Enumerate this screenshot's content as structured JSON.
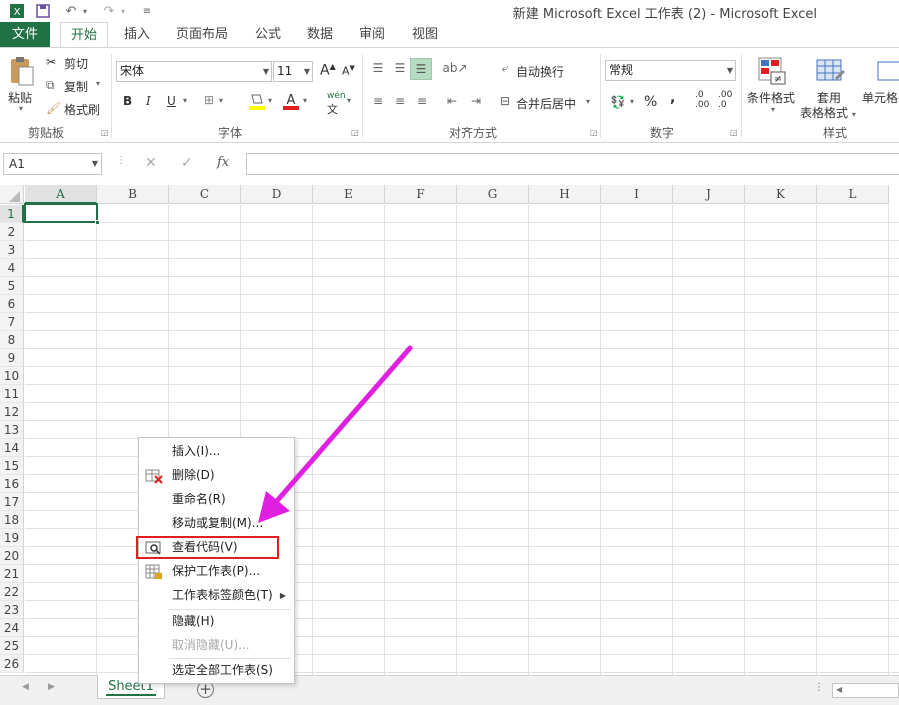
{
  "window": {
    "title": "新建 Microsoft Excel 工作表 (2) - Microsoft Excel"
  },
  "qat": {
    "icons": [
      "excel-logo-icon",
      "save-icon",
      "undo-icon",
      "redo-icon",
      "customize-icon"
    ]
  },
  "tabs": [
    {
      "id": "file",
      "label": "文件"
    },
    {
      "id": "home",
      "label": "开始"
    },
    {
      "id": "insert",
      "label": "插入"
    },
    {
      "id": "layout",
      "label": "页面布局"
    },
    {
      "id": "formulas",
      "label": "公式"
    },
    {
      "id": "data",
      "label": "数据"
    },
    {
      "id": "review",
      "label": "审阅"
    },
    {
      "id": "view",
      "label": "视图"
    }
  ],
  "ribbon": {
    "clipboard": {
      "label": "剪贴板",
      "paste": "粘贴",
      "cut": "剪切",
      "copy": "复制",
      "format_painter": "格式刷"
    },
    "font": {
      "label": "字体",
      "name": "宋体",
      "size": "11",
      "grow": "A",
      "shrink": "A",
      "bold": "B",
      "italic": "I",
      "underline": "U",
      "wen": "wén",
      "wen_char": "文"
    },
    "alignment": {
      "label": "对齐方式",
      "wrap": "自动换行",
      "merge": "合并后居中"
    },
    "number": {
      "label": "数字",
      "format": "常规",
      "percent": "%",
      "comma": ",",
      "inc": ".0\n.00",
      "dec": ".00\n.0"
    },
    "styles": {
      "label": "样式",
      "conditional": "条件格式",
      "table_format_1": "套用",
      "table_format_2": "表格格式",
      "cell_styles": "单元格"
    }
  },
  "formula_bar": {
    "name_box": "A1",
    "fx": "fx",
    "value": ""
  },
  "grid": {
    "columns": [
      "A",
      "B",
      "C",
      "D",
      "E",
      "F",
      "G",
      "H",
      "I",
      "J",
      "K",
      "L"
    ],
    "rows": [
      "1",
      "2",
      "3",
      "4",
      "5",
      "6",
      "7",
      "8",
      "9",
      "10",
      "11",
      "12",
      "13",
      "14",
      "15",
      "16",
      "17",
      "18",
      "19",
      "20",
      "21",
      "22",
      "23",
      "24",
      "25",
      "26"
    ],
    "active_cell": "A1"
  },
  "sheets": [
    {
      "name": "Sheet1"
    }
  ],
  "context_menu": {
    "items": [
      {
        "label": "插入(I)...",
        "icon": "",
        "disabled": false
      },
      {
        "label": "删除(D)",
        "icon": "delete-sheet-icon",
        "disabled": false
      },
      {
        "label": "重命名(R)",
        "icon": "",
        "disabled": false
      },
      {
        "label": "移动或复制(M)...",
        "icon": "",
        "disabled": false
      },
      {
        "label": "查看代码(V)",
        "icon": "view-code-icon",
        "disabled": false
      },
      {
        "label": "保护工作表(P)...",
        "icon": "protect-sheet-icon",
        "disabled": false
      },
      {
        "label": "工作表标签颜色(T)",
        "icon": "",
        "disabled": false,
        "submenu": true
      },
      {
        "label": "隐藏(H)",
        "icon": "",
        "disabled": false
      },
      {
        "label": "取消隐藏(U)...",
        "icon": "",
        "disabled": true
      },
      {
        "label": "选定全部工作表(S)",
        "icon": "",
        "disabled": false
      }
    ]
  },
  "colors": {
    "accent": "#217346",
    "highlight": "#e02020",
    "arrow": "#e020e0"
  }
}
